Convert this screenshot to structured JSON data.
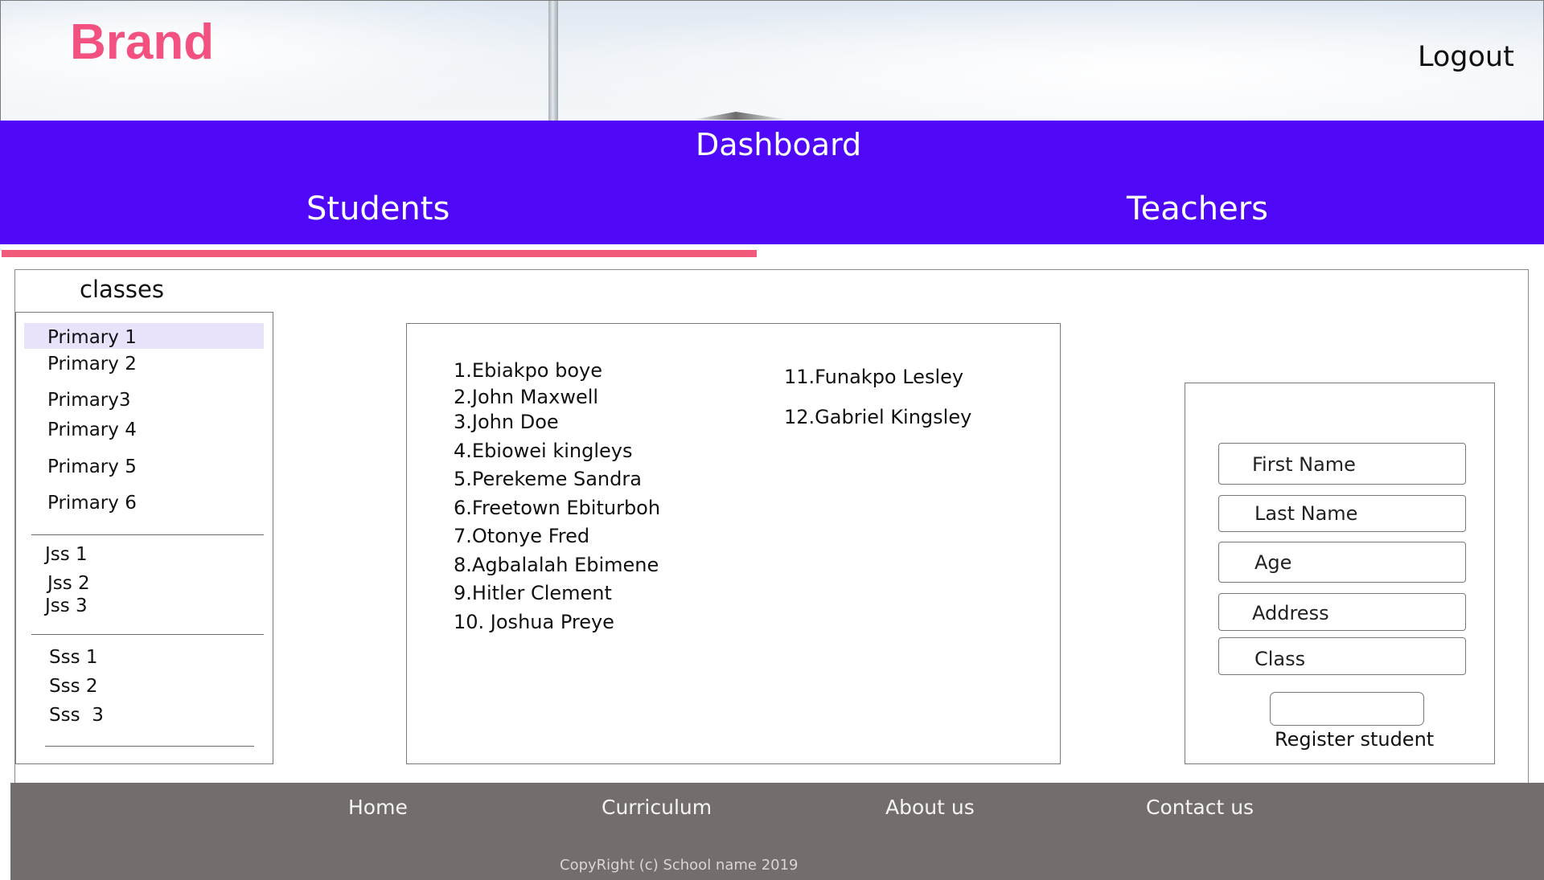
{
  "header": {
    "brand": "Brand",
    "logout_label": "Logout"
  },
  "nav": {
    "dashboard_label": "Dashboard",
    "students_label": "Students",
    "teachers_label": "Teachers",
    "active_tab": "Students"
  },
  "classes": {
    "title": "classes",
    "selected": "Primary 1",
    "primary": [
      "Primary 1",
      "Primary 2",
      "Primary3",
      "Primary 4",
      "Primary 5",
      "Primary 6"
    ],
    "jss": [
      "Jss 1",
      "Jss 2",
      "Jss 3"
    ],
    "sss": [
      "Sss 1",
      "Sss 2",
      "Sss  3"
    ]
  },
  "students": [
    "1.Ebiakpo boye",
    "2.John Maxwell",
    "3.John Doe",
    "4.Ebiowei kingleys",
    "5.Perekeme Sandra",
    "6.Freetown Ebiturboh",
    "7.Otonye Fred",
    "8.Agbalalah Ebimene",
    "9.Hitler Clement",
    "10. Joshua Preye",
    "11.Funakpo Lesley",
    "12.Gabriel Kingsley"
  ],
  "register_form": {
    "first_name_placeholder": "First Name",
    "last_name_placeholder": "Last Name",
    "age_placeholder": "Age",
    "address_placeholder": "Address",
    "class_placeholder": "Class",
    "submit_label": "Register student"
  },
  "footer": {
    "links": [
      "Home",
      "Curriculum",
      "About us",
      "Contact us"
    ],
    "copyright": "CopyRight (c) School name 2019"
  },
  "colors": {
    "brand": "#f35280",
    "nav_background": "#5008f8",
    "active_indicator": "#f25a7c",
    "selected_class_background": "#e8e3fb",
    "footer_background": "#736d6c"
  }
}
